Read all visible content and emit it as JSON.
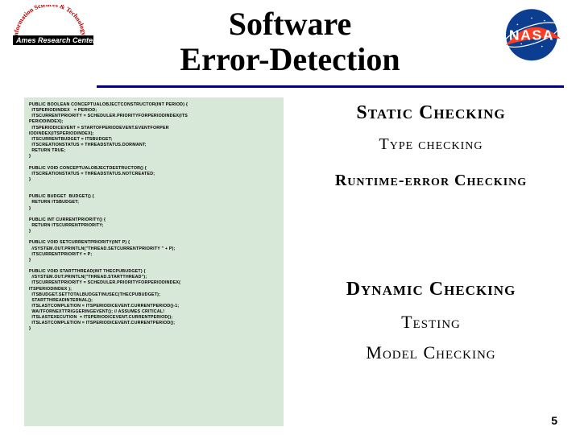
{
  "header": {
    "title_line1": "Software",
    "title_line2": "Error-Detection",
    "ames_arc": "Information Sciences & Technology",
    "ames_label": "Ames Research Center",
    "nasa_label": "NASA"
  },
  "code": "public boolean ConceptualObjectConstructor(int period) {\n  itsPeriodIndex   = period;\n  itsCurrentPriority = Scheduler.priorityForPeriodIndex(its\nPeriodIndex);\n  itsPeriodicEvent = StartOfPeriodEvent.eventForPer\niodIndex(itsPeriodIndex);\n  itsCurrentBudget = itsBudget;\n  itsCreationStatus = ThreadStatus.Dormant;\n  return true;\n}\n\npublic void ConceptualObjectDestructor() {\n  itsCreationStatus = ThreadStatus.NotCreated;\n}\n\n\npublic Budget  budget() {\n  return itsBudget;\n}\n\npublic int currentPriority() {\n  return itsCurrentPriority;\n}\n\npublic void setCurrentPriority(int p) {\n  //System.out.println(\"Thread.setCurrentPriority \" + p);\n  itsCurrentPriority = p;\n}\n\npublic void startThread(int theCPUBudget) {\n  //System.out.println(\"Thread.StartThread\");\n  itsCurrentPriority = Scheduler.priorityForPeriodIndex(\nitsPeriodIndex );\n  itsBudget.setTotalBudgetInUsec(theCPUBudget);\n  startThreadInternal();\n  itsLastCompletion = itsPeriodicEvent.currentPeriod()-1;\n  waitForNextTriggeringEvent(); // assumes critical!\n  itsLastExecution  = itsPeriodicEvent.currentPeriod();\n  itsLastCompletion = itsPeriodicEvent.currentPeriod();\n}",
  "checks": {
    "static": "Static Checking",
    "type": "Type checking",
    "runtime": "Runtime-error Checking",
    "dynamic": "Dynamic Checking",
    "testing": "Testing",
    "model": "Model Checking"
  },
  "page_number": "5"
}
